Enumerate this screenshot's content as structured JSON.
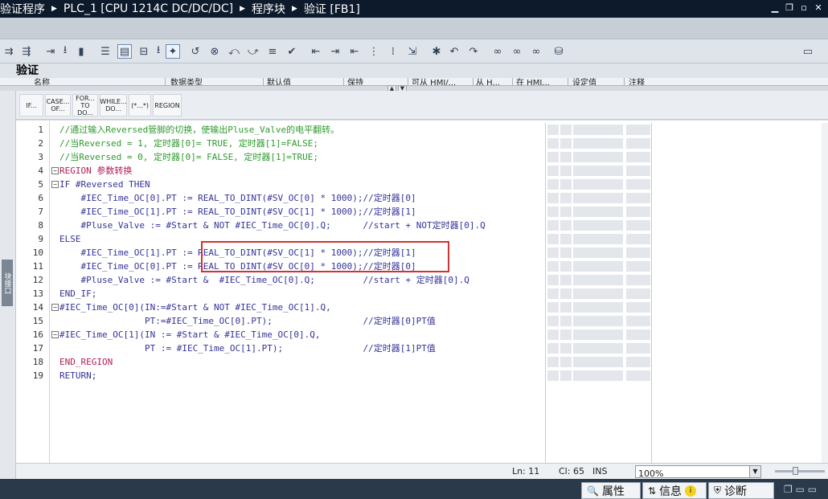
{
  "title": {
    "crumbs": [
      "验证程序",
      "PLC_1 [CPU 1214C DC/DC/DC]",
      "程序块",
      "验证 [FB1]"
    ]
  },
  "window_controls": {
    "minimize": "▁",
    "restore": "❐",
    "maximize": "▫",
    "close": "✕"
  },
  "block_name": "验证",
  "columns": [
    "名称",
    "数据类型",
    "默认值",
    "保持",
    "可从 HMI/...",
    "从 H...",
    "在 HMI...",
    "设定值",
    "注释"
  ],
  "instructions": [
    {
      "label": "IF..."
    },
    {
      "label": "CASE... OF..."
    },
    {
      "label": "FOR... TO DO..."
    },
    {
      "label": "WHILE... DO..."
    },
    {
      "label": "(*...*)"
    },
    {
      "label": "REGION"
    }
  ],
  "left_tab": "块接口",
  "code_lines": [
    {
      "n": "1",
      "text": "//通过输入Reversed管脚的切换，使输出Pluse_Valve的电平翻转。",
      "cls": "cm",
      "fold": ""
    },
    {
      "n": "2",
      "text": "//当Reversed = 1, 定时器[0]= TRUE, 定时器[1]=FALSE;",
      "cls": "cm",
      "fold": ""
    },
    {
      "n": "3",
      "text": "//当Reversed = 0, 定时器[0]= FALSE, 定时器[1]=TRUE;",
      "cls": "cm",
      "fold": ""
    },
    {
      "n": "4",
      "text": "REGION 参数转换",
      "cls": "reg",
      "fold": "−"
    },
    {
      "n": "5",
      "text": "IF #Reversed THEN",
      "cls": "kw",
      "fold": "−"
    },
    {
      "n": "6",
      "text": "    #IEC_Time_OC[0].PT := REAL_TO_DINT(#SV_OC[0] * 1000);//定时器[0]",
      "cls": "kw",
      "fold": ""
    },
    {
      "n": "7",
      "text": "    #IEC_Time_OC[1].PT := REAL_TO_DINT(#SV_OC[1] * 1000);//定时器[1]",
      "cls": "kw",
      "fold": ""
    },
    {
      "n": "8",
      "text": "    #Pluse_Valve := #Start & NOT #IEC_Time_OC[0].Q;      //start + NOT定时器[0].Q",
      "cls": "kw",
      "fold": ""
    },
    {
      "n": "9",
      "text": "ELSE",
      "cls": "kw",
      "fold": ""
    },
    {
      "n": "10",
      "text": "    #IEC_Time_OC[1].PT := REAL_TO_DINT(#SV_OC[1] * 1000);//定时器[1]",
      "cls": "kw",
      "fold": ""
    },
    {
      "n": "11",
      "text": "    #IEC_Time_OC[0].PT := REAL_TO_DINT(#SV_OC[0] * 1000);//定时器[0]",
      "cls": "kw",
      "fold": ""
    },
    {
      "n": "12",
      "text": "    #Pluse_Valve := #Start &  #IEC_Time_OC[0].Q;         //start + 定时器[0].Q",
      "cls": "kw",
      "fold": ""
    },
    {
      "n": "13",
      "text": "END_IF;",
      "cls": "kw",
      "fold": ""
    },
    {
      "n": "14",
      "text": "#IEC_Time_OC[0](IN:=#Start & NOT #IEC_Time_OC[1].Q,",
      "cls": "kw",
      "fold": "−"
    },
    {
      "n": "15",
      "text": "                PT:=#IEC_Time_OC[0].PT);                 //定时器[0]PT值",
      "cls": "kw",
      "fold": ""
    },
    {
      "n": "16",
      "text": "#IEC_Time_OC[1](IN := #Start & #IEC_Time_OC[0].Q,",
      "cls": "kw",
      "fold": "−"
    },
    {
      "n": "17",
      "text": "                PT := #IEC_Time_OC[1].PT);               //定时器[1]PT值",
      "cls": "kw",
      "fold": ""
    },
    {
      "n": "18",
      "text": "END_REGION",
      "cls": "reg",
      "fold": ""
    },
    {
      "n": "19",
      "text": "RETURN;",
      "cls": "kw",
      "fold": ""
    }
  ],
  "status": {
    "ln_label": "Ln: 11",
    "col_label": "Cl: 65",
    "mode": "INS",
    "zoom": "100%"
  },
  "bottom_tabs": {
    "properties": "属性",
    "info": "信息",
    "diagnostics": "诊断"
  },
  "colors": {
    "comment": "#2e9a2e",
    "keyword": "#333399",
    "region": "#b11e57",
    "highlight_box": "#d33232",
    "titlebar": "#0d1a2b"
  }
}
